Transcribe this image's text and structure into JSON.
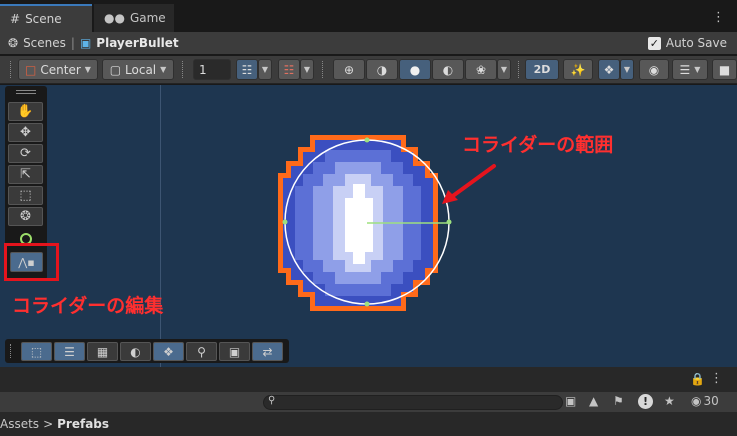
{
  "tabs": [
    {
      "label": "Scene",
      "icon": "hash-icon",
      "active": true
    },
    {
      "label": "Game",
      "icon": "gamepad-icon",
      "active": false
    }
  ],
  "breadcrumb": {
    "root": "Scenes",
    "separator": "|",
    "current": "PlayerBullet"
  },
  "autosave": {
    "label": "Auto Save",
    "checked": true
  },
  "toolbar": {
    "pivot": "Center",
    "space": "Local",
    "grid_size": "1",
    "mode_2d": "2D"
  },
  "tools": [
    "view-tool",
    "move-tool",
    "rotate-tool",
    "scale-tool",
    "rect-tool",
    "transform-tool"
  ],
  "bottom_tools": [
    "rect",
    "align",
    "pixel-grid",
    "shading",
    "layers",
    "zoom",
    "camera",
    "shuffle"
  ],
  "annotations": {
    "collider_range": "コライダーの範囲",
    "collider_edit": "コライダーの編集"
  },
  "lower": {
    "path_parent": "Assets",
    "path_sep": ">",
    "path_current": "Prefabs",
    "hidden_count": "30"
  },
  "colors": {
    "scene_bg": "#1e3650",
    "accent_red": "#ff2f2f",
    "collider_orange": "#ff6a1a",
    "selected_blue": "#4b6b8e"
  }
}
